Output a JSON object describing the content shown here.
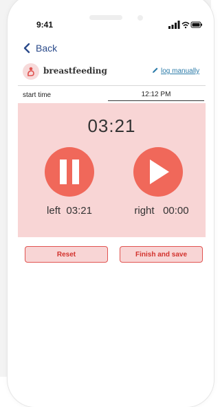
{
  "status_bar": {
    "time": "9:41"
  },
  "nav": {
    "back_label": "Back"
  },
  "header": {
    "title": "breastfeeding",
    "log_manually": "log manually"
  },
  "start_time": {
    "label": "start time",
    "value": "12:12 PM"
  },
  "timer": {
    "total": "03:21",
    "left_label": "left",
    "left_time": "03:21",
    "right_label": "right",
    "right_time": "00:00"
  },
  "actions": {
    "reset": "Reset",
    "finish": "Finish and save"
  },
  "colors": {
    "accent": "#f0685a",
    "panel": "#f8d5d5",
    "link": "#2a7aa8",
    "back": "#2a4a8a"
  }
}
